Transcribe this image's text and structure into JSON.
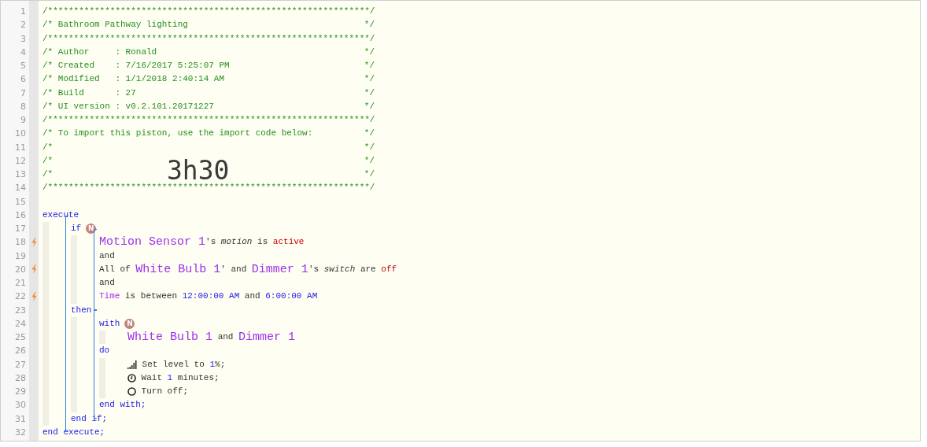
{
  "overlay_text": "3h30",
  "lines": [
    {
      "number": "1",
      "trigger": false,
      "tokens": [
        {
          "kind": "comment",
          "text": "/**************************************************************/"
        }
      ]
    },
    {
      "number": "2",
      "trigger": false,
      "tokens": [
        {
          "kind": "comment",
          "text": "/* Bathroom Pathway lighting"
        },
        {
          "kind": "close",
          "text": "*/"
        }
      ]
    },
    {
      "number": "3",
      "trigger": false,
      "tokens": [
        {
          "kind": "comment",
          "text": "/**************************************************************/"
        }
      ]
    },
    {
      "number": "4",
      "trigger": false,
      "tokens": [
        {
          "kind": "comment",
          "text": "/* Author     : Ronald"
        },
        {
          "kind": "close",
          "text": "*/"
        }
      ]
    },
    {
      "number": "5",
      "trigger": false,
      "tokens": [
        {
          "kind": "comment",
          "text": "/* Created    : 7/16/2017 5:25:07 PM"
        },
        {
          "kind": "close",
          "text": "*/"
        }
      ]
    },
    {
      "number": "6",
      "trigger": false,
      "tokens": [
        {
          "kind": "comment",
          "text": "/* Modified   : 1/1/2018 2:40:14 AM"
        },
        {
          "kind": "close",
          "text": "*/"
        }
      ]
    },
    {
      "number": "7",
      "trigger": false,
      "tokens": [
        {
          "kind": "comment",
          "text": "/* Build      : 27"
        },
        {
          "kind": "close",
          "text": "*/"
        }
      ]
    },
    {
      "number": "8",
      "trigger": false,
      "tokens": [
        {
          "kind": "comment",
          "text": "/* UI version : v0.2.101.20171227"
        },
        {
          "kind": "close",
          "text": "*/"
        }
      ]
    },
    {
      "number": "9",
      "trigger": false,
      "tokens": [
        {
          "kind": "comment",
          "text": "/**************************************************************/"
        }
      ]
    },
    {
      "number": "10",
      "trigger": false,
      "tokens": [
        {
          "kind": "comment",
          "text": "/* To import this piston, use the import code below:"
        },
        {
          "kind": "close",
          "text": "*/"
        }
      ]
    },
    {
      "number": "11",
      "trigger": false,
      "tokens": [
        {
          "kind": "comment",
          "text": "/*"
        },
        {
          "kind": "close",
          "text": "*/"
        }
      ]
    },
    {
      "number": "12",
      "trigger": false,
      "tokens": [
        {
          "kind": "comment",
          "text": "/*"
        },
        {
          "kind": "close",
          "text": "*/"
        }
      ]
    },
    {
      "number": "13",
      "trigger": false,
      "tokens": [
        {
          "kind": "comment",
          "text": "/*"
        },
        {
          "kind": "close",
          "text": "*/"
        }
      ]
    },
    {
      "number": "14",
      "trigger": false,
      "tokens": [
        {
          "kind": "comment",
          "text": "/**************************************************************/"
        }
      ]
    },
    {
      "number": "15",
      "trigger": false
    },
    {
      "number": "16",
      "trigger": false,
      "tokens": [
        {
          "kind": "keyword",
          "text": "execute"
        }
      ],
      "bracket": true,
      "children": [
        {
          "number": "17",
          "trigger": false,
          "tokens": [
            {
              "kind": "keyword",
              "text": "if"
            },
            {
              "kind": "badge",
              "text": "N"
            }
          ],
          "bracket": true,
          "children": [
            {
              "number": "18",
              "trigger": true,
              "tokens": [
                {
                  "kind": "device",
                  "text": "Motion Sensor 1"
                },
                {
                  "kind": "text",
                  "text": "'s "
                },
                {
                  "kind": "italic",
                  "text": "motion"
                },
                {
                  "kind": "text",
                  "text": " is "
                },
                {
                  "kind": "value",
                  "text": "active"
                }
              ]
            },
            {
              "number": "19",
              "trigger": false,
              "tokens": [
                {
                  "kind": "text",
                  "text": "and"
                }
              ]
            },
            {
              "number": "20",
              "trigger": true,
              "tokens": [
                {
                  "kind": "text",
                  "text": "All of "
                },
                {
                  "kind": "device",
                  "text": "White Bulb 1"
                },
                {
                  "kind": "text",
                  "text": "' and "
                },
                {
                  "kind": "device",
                  "text": "Dimmer 1"
                },
                {
                  "kind": "text",
                  "text": "'s "
                },
                {
                  "kind": "italic",
                  "text": "switch"
                },
                {
                  "kind": "text",
                  "text": " are "
                },
                {
                  "kind": "value",
                  "text": "off"
                }
              ]
            },
            {
              "number": "21",
              "trigger": false,
              "tokens": [
                {
                  "kind": "text",
                  "text": "and"
                }
              ]
            },
            {
              "number": "22",
              "trigger": true,
              "tokens": [
                {
                  "kind": "variable",
                  "text": "Time"
                },
                {
                  "kind": "text",
                  "text": " is between "
                },
                {
                  "kind": "number",
                  "text": "12:00:00 AM"
                },
                {
                  "kind": "text",
                  "text": " and "
                },
                {
                  "kind": "number",
                  "text": "6:00:00 AM"
                }
              ]
            }
          ]
        },
        {
          "number": "23",
          "trigger": false,
          "tokens": [
            {
              "kind": "keyword",
              "text": "then"
            }
          ],
          "bracket": true,
          "children": [
            {
              "number": "24",
              "trigger": false,
              "tokens": [
                {
                  "kind": "keyword",
                  "text": "with"
                },
                {
                  "kind": "badge",
                  "text": "N"
                }
              ],
              "bracket": false,
              "children": [
                {
                  "number": "25",
                  "trigger": false,
                  "tokens": [
                    {
                      "kind": "device",
                      "text": "White Bulb 1"
                    },
                    {
                      "kind": "text",
                      "text": " and "
                    },
                    {
                      "kind": "device",
                      "text": "Dimmer 1"
                    }
                  ]
                }
              ]
            },
            {
              "number": "26",
              "trigger": false,
              "tokens": [
                {
                  "kind": "keyword",
                  "text": "do"
                }
              ],
              "bracket": false,
              "children": [
                {
                  "number": "27",
                  "trigger": false,
                  "tokens": [
                    {
                      "kind": "signal"
                    },
                    {
                      "kind": "text",
                      "text": " Set level to "
                    },
                    {
                      "kind": "number",
                      "text": "1"
                    },
                    {
                      "kind": "text",
                      "text": "%;"
                    }
                  ]
                },
                {
                  "number": "28",
                  "trigger": false,
                  "tokens": [
                    {
                      "kind": "clock"
                    },
                    {
                      "kind": "text",
                      "text": " Wait "
                    },
                    {
                      "kind": "number",
                      "text": "1"
                    },
                    {
                      "kind": "text",
                      "text": " minutes;"
                    }
                  ]
                },
                {
                  "number": "29",
                  "trigger": false,
                  "tokens": [
                    {
                      "kind": "ring"
                    },
                    {
                      "kind": "text",
                      "text": " Turn off;"
                    }
                  ]
                }
              ]
            },
            {
              "number": "30",
              "trigger": false,
              "tokens": [
                {
                  "kind": "keyword",
                  "text": "end with;"
                }
              ]
            }
          ]
        },
        {
          "number": "31",
          "trigger": false,
          "tokens": [
            {
              "kind": "keyword",
              "text": "end if;"
            }
          ]
        }
      ]
    },
    {
      "number": "32",
      "trigger": false,
      "tokens": [
        {
          "kind": "keyword",
          "text": "end execute;"
        }
      ]
    }
  ]
}
